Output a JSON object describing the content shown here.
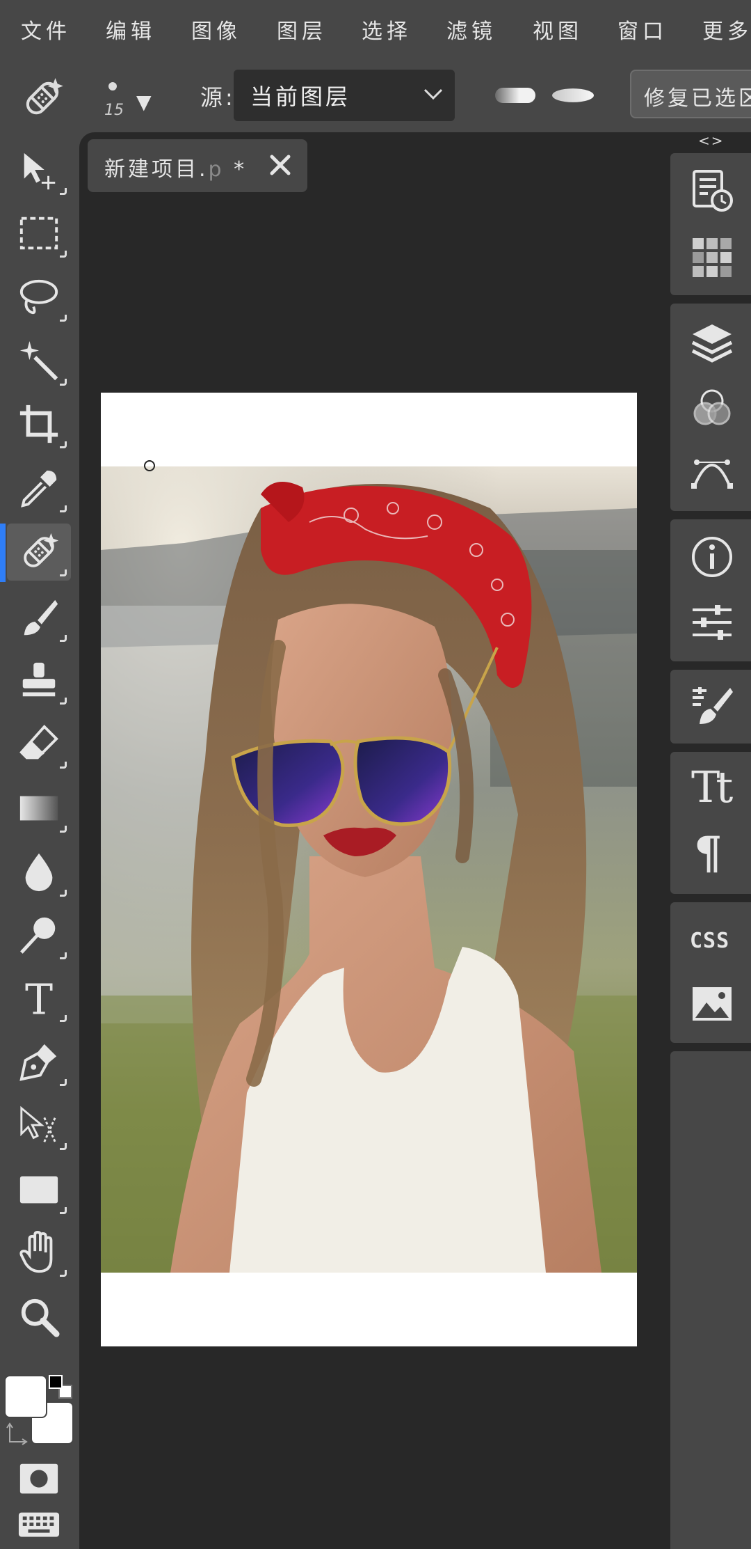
{
  "menu": [
    "文件",
    "编辑",
    "图像",
    "图层",
    "选择",
    "滤镜",
    "视图",
    "窗口",
    "更多"
  ],
  "options": {
    "brush_size": "15",
    "source_label": "源:",
    "source_value": "当前图层",
    "heal_selected_label": "修复已选区"
  },
  "document": {
    "tab_name": "新建项目.",
    "tab_ext_faded": "p",
    "tab_modified": " *"
  },
  "right_panel": {
    "toggle": "<>",
    "type_icon_text": "Tt",
    "para_icon_text": "¶",
    "css_label": "CSS"
  },
  "toolbar": {
    "active_tool": "healing-brush",
    "tools": [
      "move",
      "marquee",
      "lasso",
      "magic-wand",
      "crop",
      "eyedropper",
      "healing-brush",
      "brush",
      "clone-stamp",
      "eraser",
      "gradient",
      "blur",
      "dodge",
      "type",
      "pen",
      "path-select",
      "shape",
      "hand",
      "zoom"
    ]
  },
  "colors": {
    "accent": "#2f7ef7",
    "foreground": "#ffffff",
    "background": "#ffffff"
  }
}
